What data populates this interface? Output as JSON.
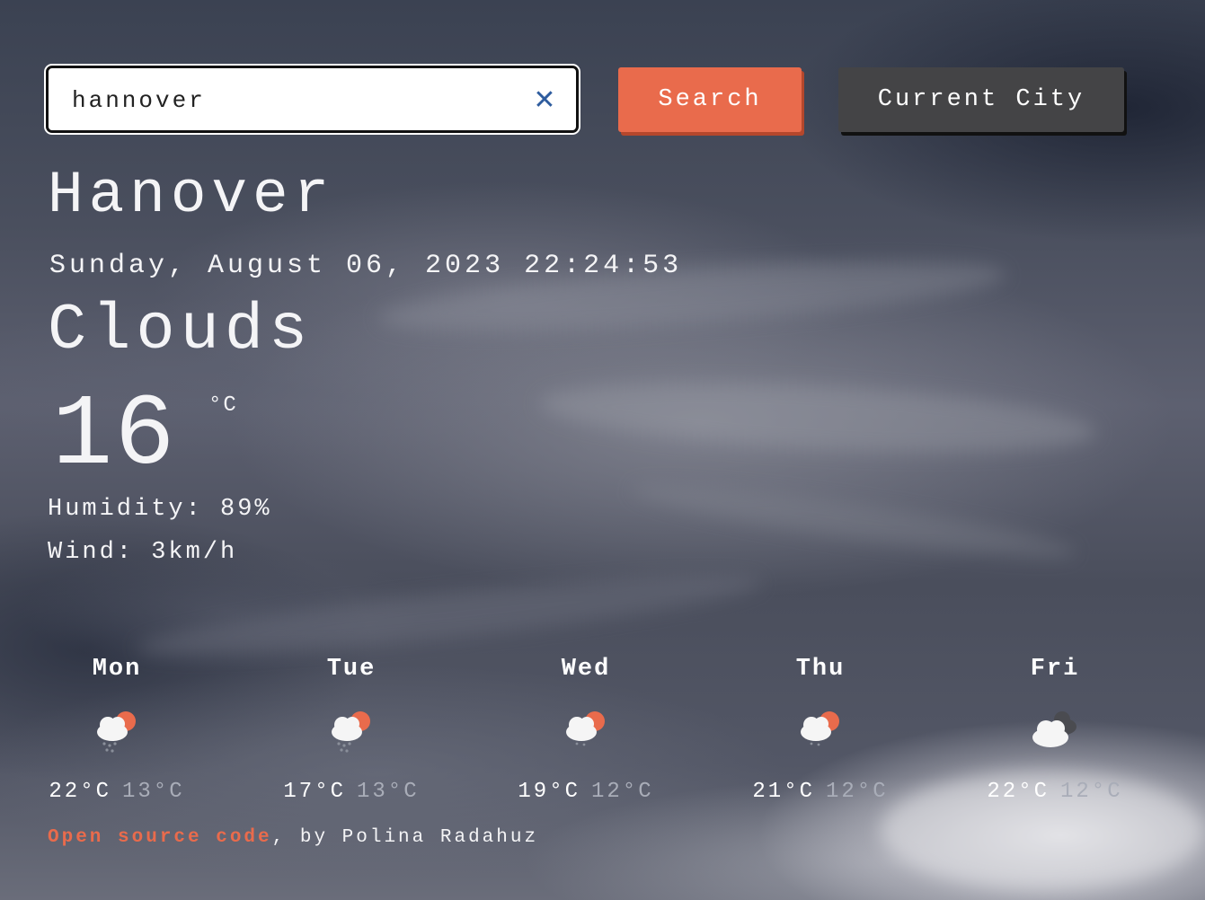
{
  "search": {
    "value": "hannover",
    "clear_label": "✕",
    "search_label": "Search",
    "current_city_label": "Current City"
  },
  "current": {
    "city": "Hanover",
    "datetime": "Sunday, August 06, 2023 22:24:53",
    "condition": "Clouds",
    "temperature": "16",
    "unit": "°C",
    "humidity": "Humidity: 89%",
    "wind": "Wind: 3km/h"
  },
  "forecast": [
    {
      "day": "Mon",
      "max": "22°C",
      "min": "13°C",
      "icon": "cloud-sun-rain-icon"
    },
    {
      "day": "Tue",
      "max": "17°C",
      "min": "13°C",
      "icon": "cloud-sun-rain-icon"
    },
    {
      "day": "Wed",
      "max": "19°C",
      "min": "12°C",
      "icon": "cloud-sun-icon"
    },
    {
      "day": "Thu",
      "max": "21°C",
      "min": "12°C",
      "icon": "cloud-sun-icon"
    },
    {
      "day": "Fri",
      "max": "22°C",
      "min": "12°C",
      "icon": "clouds-icon"
    }
  ],
  "footer": {
    "link_label": "Open source code",
    "suffix": ", by Polina Radahuz"
  },
  "colors": {
    "accent": "#e96b4c",
    "button_dark": "#444446",
    "clear_icon": "#2e5c9e"
  }
}
